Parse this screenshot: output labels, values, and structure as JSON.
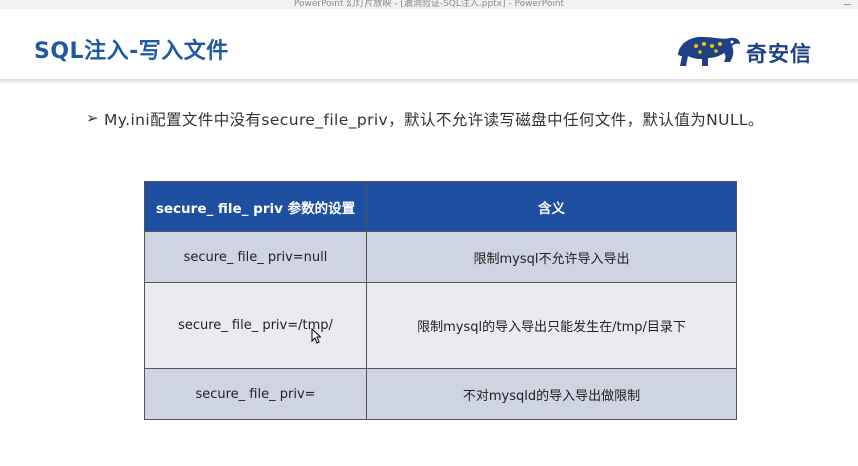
{
  "window": {
    "title": "PowerPoint 幻灯片放映 - [漏洞验证-SQL注入.pptx] - PowerPoint"
  },
  "slide": {
    "title": "SQL注入-写入文件",
    "logo_text": "奇安信",
    "bullet": "My.ini配置文件中没有secure_file_priv，默认不允许读写磁盘中任何文件，默认值为NULL。",
    "table": {
      "headers": [
        "secure_ file_ priv 参数的设置",
        "含义"
      ],
      "rows": [
        [
          "secure_ file_ priv=null",
          "限制mysql不允许导入导出"
        ],
        [
          "secure_ file_ priv=/tmp/",
          "限制mysql的导入导出只能发生在/tmp/目录下"
        ],
        [
          "secure_ file_ priv=",
          "不对mysqld的导入导出做限制"
        ]
      ]
    }
  },
  "colors": {
    "title": "#1e5aa0",
    "table_header": "#1f4fa0",
    "row_dark": "#cfd4e2",
    "row_light": "#e9ebf1",
    "logo": "#1f3f86"
  },
  "icons": {
    "logo": "qianxin-cheetah-icon",
    "bullet": "arrow-bullet-icon",
    "cursor": "mouse-pointer-icon"
  }
}
